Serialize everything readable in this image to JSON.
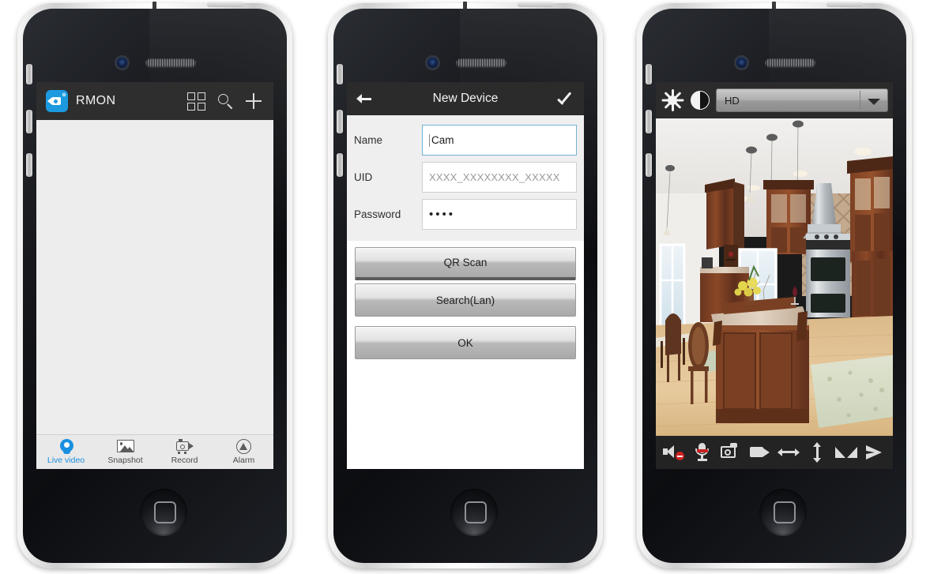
{
  "screen1": {
    "appbar": {
      "logo_icon": "camcorder-app-icon",
      "title": "RMON",
      "grid_icon": "grid-view-icon",
      "search_icon": "search-icon",
      "add_icon": "plus-icon"
    },
    "list_empty": "",
    "tabs": [
      {
        "label": "Live video",
        "icon": "live-video-icon",
        "active": true
      },
      {
        "label": "Snapshot",
        "icon": "snapshot-icon",
        "active": false
      },
      {
        "label": "Record",
        "icon": "record-icon",
        "active": false
      },
      {
        "label": "Alarm",
        "icon": "alarm-icon",
        "active": false
      }
    ]
  },
  "screen2": {
    "navbar": {
      "back_icon": "back-arrow-icon",
      "title": "New Device",
      "confirm_icon": "checkmark-icon"
    },
    "fields": [
      {
        "label": "Name",
        "value": "Cam",
        "placeholder": "",
        "focused": true,
        "masked": false
      },
      {
        "label": "UID",
        "value": "",
        "placeholder": "XXXX_XXXXXXXX_XXXXX",
        "focused": false,
        "masked": false
      },
      {
        "label": "Password",
        "value": "••••",
        "placeholder": "",
        "focused": false,
        "masked": true
      }
    ],
    "buttons": [
      {
        "label": "QR Scan"
      },
      {
        "label": "Search(Lan)"
      },
      {
        "label": "OK"
      }
    ]
  },
  "screen3": {
    "toolbar": {
      "brightness_icon": "brightness-sun-icon",
      "contrast_icon": "contrast-icon",
      "quality_value": "HD",
      "quality_caret": "chevron-down-icon"
    },
    "video": {
      "scene": "kitchen-live-view"
    },
    "controls": [
      {
        "icon": "speaker-muted-icon",
        "name": "speaker-toggle"
      },
      {
        "icon": "microphone-muted-icon",
        "name": "microphone-toggle"
      },
      {
        "icon": "camera-snapshot-icon",
        "name": "snapshot-button"
      },
      {
        "icon": "camcorder-record-icon",
        "name": "record-button"
      },
      {
        "icon": "horizontal-pan-icon",
        "name": "horizontal-pan-button"
      },
      {
        "icon": "vertical-tilt-icon",
        "name": "vertical-tilt-button"
      },
      {
        "icon": "mirror-flip-icon",
        "name": "mirror-flip-button"
      },
      {
        "icon": "play-arrow-icon",
        "name": "play-button"
      }
    ]
  },
  "colors": {
    "accent": "#1b8fe0",
    "appbar": "#2e2e2e",
    "navbar": "#2b2b2b",
    "focus_border": "#73b2d6",
    "alert_red": "#cc2222"
  }
}
